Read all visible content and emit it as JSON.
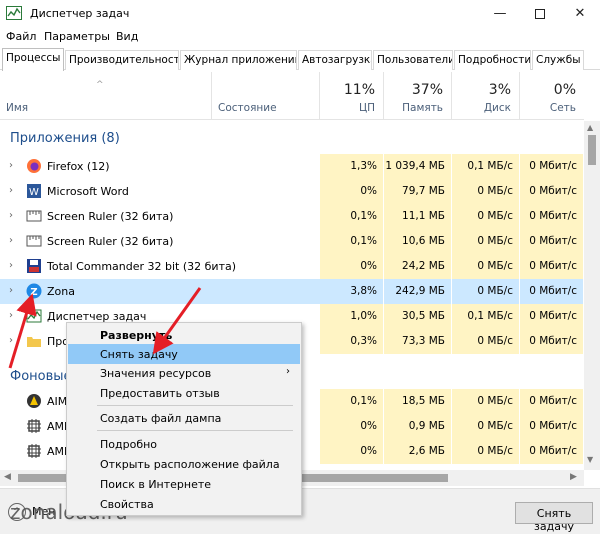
{
  "window": {
    "title": "Диспетчер задач"
  },
  "menu": [
    "Файл",
    "Параметры",
    "Вид"
  ],
  "tabs": [
    "Процессы",
    "Производительность",
    "Журнал приложений",
    "Автозагрузка",
    "Пользователи",
    "Подробности",
    "Службы"
  ],
  "columns": {
    "name": "Имя",
    "status": "Состояние",
    "cpu": {
      "pct": "11%",
      "label": "ЦП"
    },
    "mem": {
      "pct": "37%",
      "label": "Память"
    },
    "disk": {
      "pct": "3%",
      "label": "Диск"
    },
    "net": {
      "pct": "0%",
      "label": "Сеть"
    }
  },
  "groups": {
    "apps": "Приложения (8)",
    "background": "Фоновые"
  },
  "rows": [
    {
      "name": "Firefox (12)",
      "cpu": "1,3%",
      "mem": "1 039,4 МБ",
      "disk": "0,1 МБ/с",
      "net": "0 Мбит/с",
      "icon": "firefox-icon"
    },
    {
      "name": "Microsoft Word",
      "cpu": "0%",
      "mem": "79,7 МБ",
      "disk": "0 МБ/с",
      "net": "0 Мбит/с",
      "icon": "word-icon"
    },
    {
      "name": "Screen Ruler (32 бита)",
      "cpu": "0,1%",
      "mem": "11,1 МБ",
      "disk": "0 МБ/с",
      "net": "0 Мбит/с",
      "icon": "ruler-icon"
    },
    {
      "name": "Screen Ruler (32 бита)",
      "cpu": "0,1%",
      "mem": "10,6 МБ",
      "disk": "0 МБ/с",
      "net": "0 Мбит/с",
      "icon": "ruler-icon"
    },
    {
      "name": "Total Commander 32 bit (32 бита)",
      "cpu": "0%",
      "mem": "24,2 МБ",
      "disk": "0 МБ/с",
      "net": "0 Мбит/с",
      "icon": "floppy-icon"
    },
    {
      "name": "Zona",
      "cpu": "3,8%",
      "mem": "242,9 МБ",
      "disk": "0 МБ/с",
      "net": "0 Мбит/с",
      "icon": "zona-icon"
    },
    {
      "name": "Диспетчер задач",
      "cpu": "1,0%",
      "mem": "30,5 МБ",
      "disk": "0,1 МБ/с",
      "net": "0 Мбит/с",
      "icon": "taskmgr-icon"
    },
    {
      "name": "Про",
      "cpu": "0,3%",
      "mem": "73,3 МБ",
      "disk": "0 МБ/с",
      "net": "0 Мбит/с",
      "icon": "folder-icon"
    },
    {
      "name": "AIM",
      "cpu": "0,1%",
      "mem": "18,5 МБ",
      "disk": "0 МБ/с",
      "net": "0 Мбит/с",
      "icon": "aim-icon"
    },
    {
      "name": "AMD",
      "cpu": "0%",
      "mem": "0,9 МБ",
      "disk": "0 МБ/с",
      "net": "0 Мбит/с",
      "icon": "amd-icon"
    },
    {
      "name": "AMD",
      "cpu": "0%",
      "mem": "2,6 МБ",
      "disk": "0 МБ/с",
      "net": "0 Мбит/с",
      "icon": "amd-icon"
    }
  ],
  "context_menu": {
    "expand": "Развернуть",
    "end_task": "Снять задачу",
    "resource_values": "Значения ресурсов",
    "feedback": "Предоставить отзыв",
    "dump": "Создать файл дампа",
    "details": "Подробно",
    "open_location": "Открыть расположение файла",
    "search_online": "Поиск в Интернете",
    "properties": "Свойства"
  },
  "footer": {
    "less": "Мен",
    "end_task": "Снять задачу"
  },
  "watermark": "zonaload.ru",
  "colors": {
    "cell_bg": "#fff4c4",
    "selected": "#cce8ff",
    "hover": "#91c9f7",
    "arrow": "#e41e26",
    "group": "#1e4e8c"
  }
}
